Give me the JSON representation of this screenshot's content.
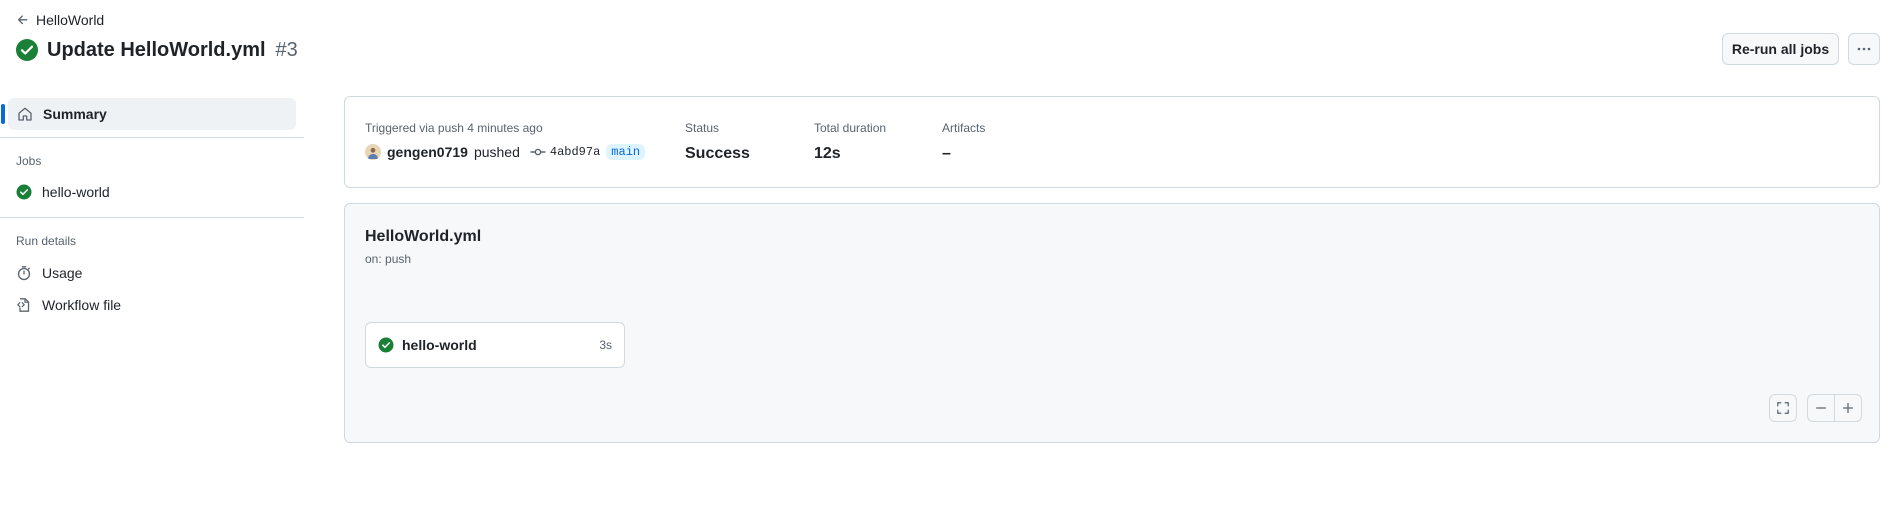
{
  "header": {
    "back_label": "HelloWorld",
    "title": "Update HelloWorld.yml",
    "run_number": "#3",
    "rerun_label": "Re-run all jobs"
  },
  "sidebar": {
    "summary_label": "Summary",
    "jobs_heading": "Jobs",
    "jobs": [
      {
        "label": "hello-world",
        "status": "success"
      }
    ],
    "run_details_heading": "Run details",
    "run_details": [
      {
        "label": "Usage",
        "icon": "stopwatch-icon"
      },
      {
        "label": "Workflow file",
        "icon": "file-code-icon"
      }
    ]
  },
  "summary": {
    "trigger_text": "Triggered via push 4 minutes ago",
    "actor": "gengen0719",
    "action": "pushed",
    "commit_sha": "4abd97a",
    "branch": "main",
    "status_label": "Status",
    "status_value": "Success",
    "duration_label": "Total duration",
    "duration_value": "12s",
    "artifacts_label": "Artifacts",
    "artifacts_value": "–"
  },
  "workflow": {
    "name": "HelloWorld.yml",
    "trigger": "on: push",
    "jobs": [
      {
        "name": "hello-world",
        "duration": "3s",
        "status": "success"
      }
    ]
  },
  "colors": {
    "success": "#1a7f37",
    "accent": "#0969da",
    "border": "#d1d9e0",
    "muted": "#59636e"
  }
}
